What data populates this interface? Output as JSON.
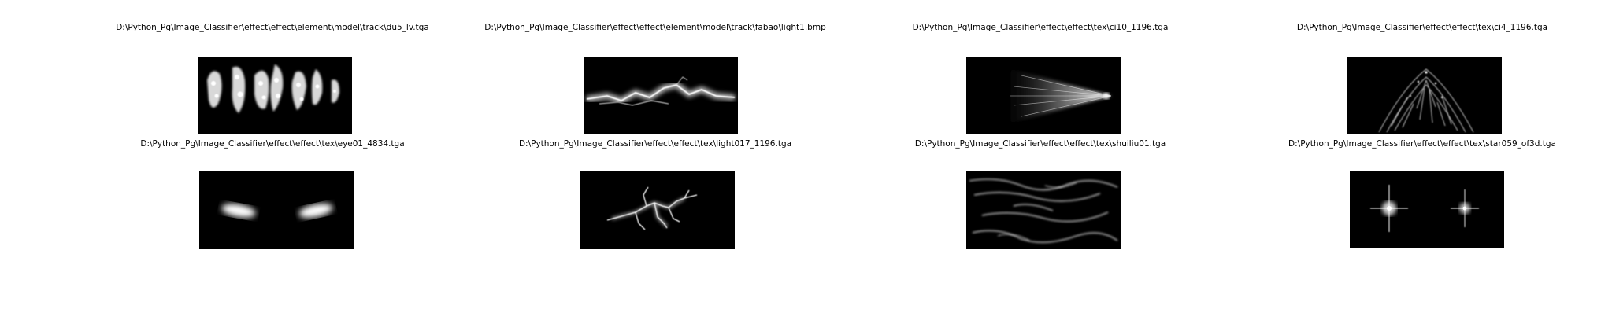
{
  "figure": {
    "tiles": [
      {
        "title": "D:\\Python_Pg\\Image_Classifier\\effect\\effect\\element\\model\\track\\du5_lv.tga",
        "image": "white-flame-streaks-image"
      },
      {
        "title": "D:\\Python_Pg\\Image_Classifier\\effect\\effect\\element\\model\\track\\fabao\\light1.bmp",
        "image": "lightning-bolt-image"
      },
      {
        "title": "D:\\Python_Pg\\Image_Classifier\\effect\\effect\\tex\\ci10_1196.tga",
        "image": "light-ray-cone-image"
      },
      {
        "title": "D:\\Python_Pg\\Image_Classifier\\effect\\effect\\tex\\ci4_1196.tga",
        "image": "sparkle-arc-image"
      },
      {
        "title": "D:\\Python_Pg\\Image_Classifier\\effect\\effect\\tex\\eye01_4834.tga",
        "image": "glowing-eyes-image"
      },
      {
        "title": "D:\\Python_Pg\\Image_Classifier\\effect\\effect\\tex\\light017_1196.tga",
        "image": "branching-lightning-image"
      },
      {
        "title": "D:\\Python_Pg\\Image_Classifier\\effect\\effect\\tex\\shuiliu01.tga",
        "image": "water-flow-streaks-image"
      },
      {
        "title": "D:\\Python_Pg\\Image_Classifier\\effect\\effect\\tex\\star059_of3d.tga",
        "image": "twin-star-flares-image"
      }
    ]
  }
}
